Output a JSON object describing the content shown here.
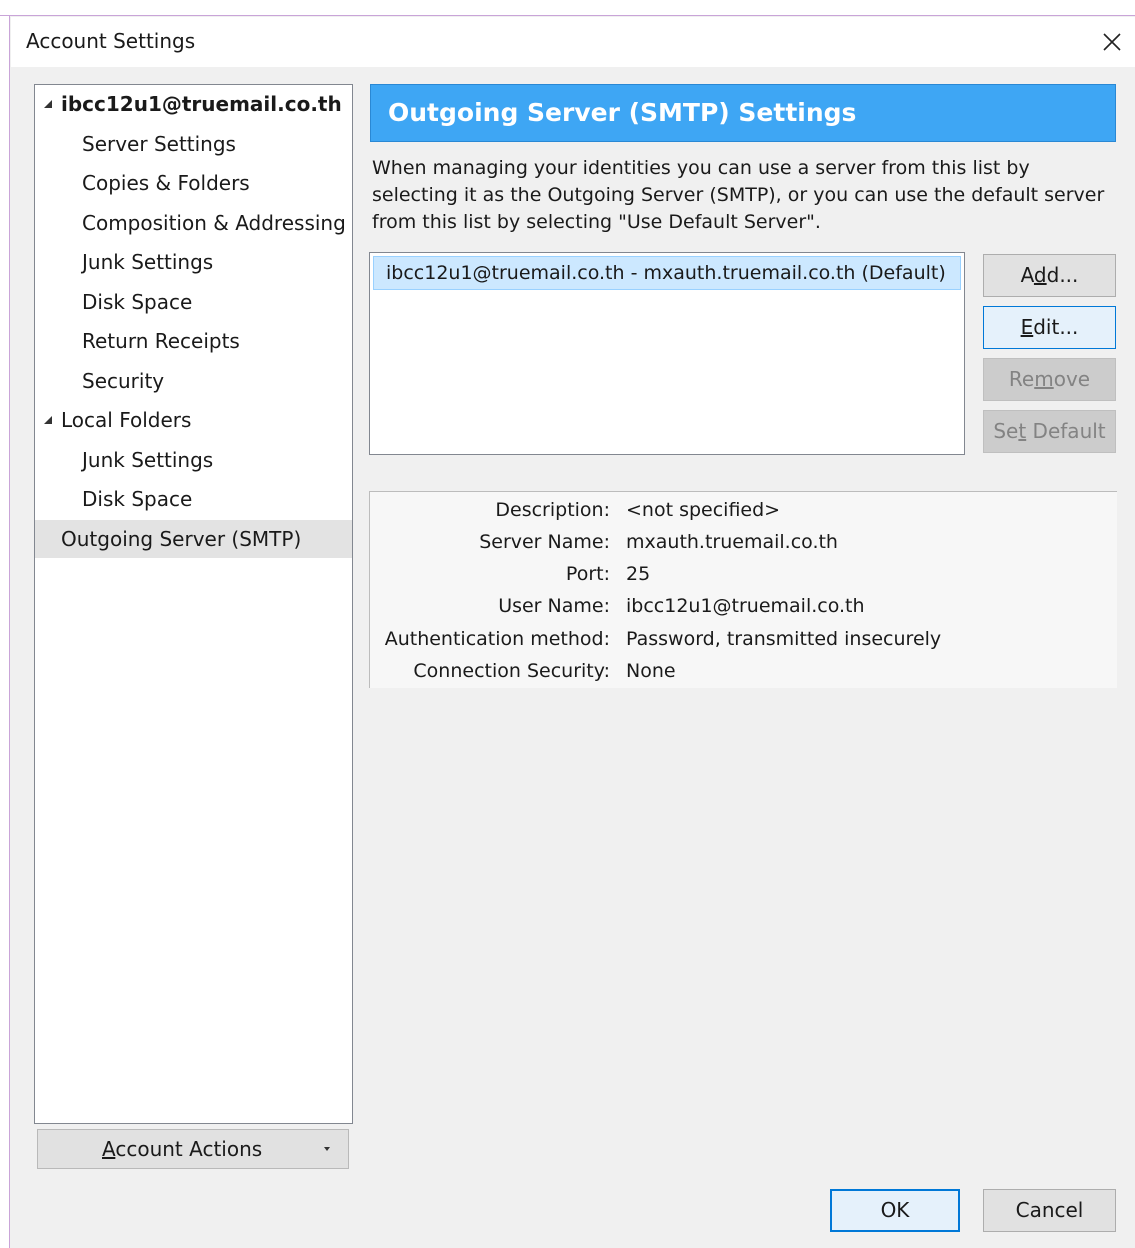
{
  "window": {
    "title": "Account Settings"
  },
  "tree": {
    "account": "ibcc12u1@truemail.co.th",
    "account_items": [
      "Server Settings",
      "Copies & Folders",
      "Composition & Addressing",
      "Junk Settings",
      "Disk Space",
      "Return Receipts",
      "Security"
    ],
    "local": "Local Folders",
    "local_items": [
      "Junk Settings",
      "Disk Space"
    ],
    "outgoing": "Outgoing Server (SMTP)"
  },
  "account_actions": {
    "pre": "",
    "key": "A",
    "post": "ccount Actions"
  },
  "panel": {
    "title": "Outgoing Server (SMTP) Settings",
    "intro": "When managing your identities you can use a server from this list by selecting it as the Outgoing Server (SMTP), or you can use the default server from this list by selecting \"Use Default Server\".",
    "servers": [
      "ibcc12u1@truemail.co.th - mxauth.truemail.co.th (Default)"
    ]
  },
  "buttons": {
    "add": {
      "pre": "A",
      "key": "d",
      "post": "d..."
    },
    "edit": {
      "pre": "",
      "key": "E",
      "post": "dit..."
    },
    "remove": {
      "pre": "Re",
      "key": "m",
      "post": "ove"
    },
    "set_default": {
      "pre": "Se",
      "key": "t",
      "post": " Default"
    },
    "ok": "OK",
    "cancel": "Cancel"
  },
  "details": {
    "description_label": "Description:",
    "description": "<not specified>",
    "server_label": "Server Name:",
    "server": "mxauth.truemail.co.th",
    "port_label": "Port:",
    "port": "25",
    "user_label": "User Name:",
    "user": "ibcc12u1@truemail.co.th",
    "auth_label": "Authentication method:",
    "auth": "Password, transmitted insecurely",
    "security_label": "Connection Security:",
    "security": "None"
  },
  "colors": {
    "accent": "#3ea6f4",
    "selection": "#cce8ff",
    "focus": "#0078d7"
  }
}
